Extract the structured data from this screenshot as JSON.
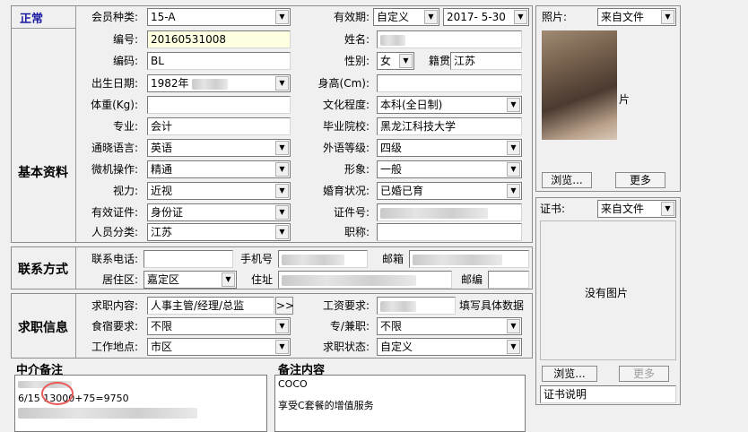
{
  "status": "正常",
  "basic": {
    "section": "基本资料",
    "member_type": {
      "label": "会员种类:",
      "value": "15-A"
    },
    "validity": {
      "label": "有效期:",
      "mode": "自定义",
      "date": "2017- 5-30"
    },
    "code": {
      "label": "编号:",
      "value": "20160531008"
    },
    "name": {
      "label": "姓名:"
    },
    "code2": {
      "label": "编码:",
      "value": "BL"
    },
    "gender": {
      "label": "性别:",
      "value": "女"
    },
    "native": {
      "label": "籍贯",
      "value": "江苏"
    },
    "birth": {
      "label": "出生日期:",
      "value": "1982年"
    },
    "height": {
      "label": "身高(Cm):"
    },
    "weight": {
      "label": "体重(Kg):"
    },
    "education": {
      "label": "文化程度:",
      "value": "本科(全日制)"
    },
    "major": {
      "label": "专业:",
      "value": "会计"
    },
    "school": {
      "label": "毕业院校:",
      "value": "黑龙江科技大学"
    },
    "language": {
      "label": "通晓语言:",
      "value": "英语"
    },
    "lang_level": {
      "label": "外语等级:",
      "value": "四级"
    },
    "computer": {
      "label": "微机操作:",
      "value": "精通"
    },
    "appearance": {
      "label": "形象:",
      "value": "一般"
    },
    "vision": {
      "label": "视力:",
      "value": "近视"
    },
    "marital": {
      "label": "婚育状况:",
      "value": "已婚已育"
    },
    "id_type": {
      "label": "有效证件:",
      "value": "身份证"
    },
    "id_no": {
      "label": "证件号:"
    },
    "category": {
      "label": "人员分类:",
      "value": "江苏"
    },
    "title": {
      "label": "职称:"
    }
  },
  "contact": {
    "section": "联系方式",
    "phone": {
      "label": "联系电话:"
    },
    "mobile": {
      "label": "手机号"
    },
    "email": {
      "label": "邮箱"
    },
    "district": {
      "label": "居住区:",
      "value": "嘉定区"
    },
    "address": {
      "label": "住址"
    },
    "zipcode": {
      "label": "邮编"
    }
  },
  "job": {
    "section": "求职信息",
    "content": {
      "label": "求职内容:",
      "value": "人事主管/经理/总监",
      "btn": ">>"
    },
    "salary": {
      "label": "工资要求:",
      "hint": "填写具体数据"
    },
    "board": {
      "label": "食宿要求:",
      "value": "不限"
    },
    "parttime": {
      "label": "专/兼职:",
      "value": "不限"
    },
    "location": {
      "label": "工作地点:",
      "value": "市区"
    },
    "status": {
      "label": "求职状态:",
      "value": "自定义"
    }
  },
  "agency_notes": {
    "title": "中介备注",
    "line1": "6/15  13000+75=9750"
  },
  "notes": {
    "title": "备注内容",
    "line1": "COCO",
    "line2": "享受C套餐的增值服务"
  },
  "photo": {
    "label": "照片:",
    "source": "来自文件",
    "partial": "片",
    "browse": "浏览...",
    "more": "更多"
  },
  "cert": {
    "label": "证书:",
    "source": "来自文件",
    "empty": "没有图片",
    "browse": "浏览...",
    "more": "更多",
    "desc": "证书说明"
  }
}
